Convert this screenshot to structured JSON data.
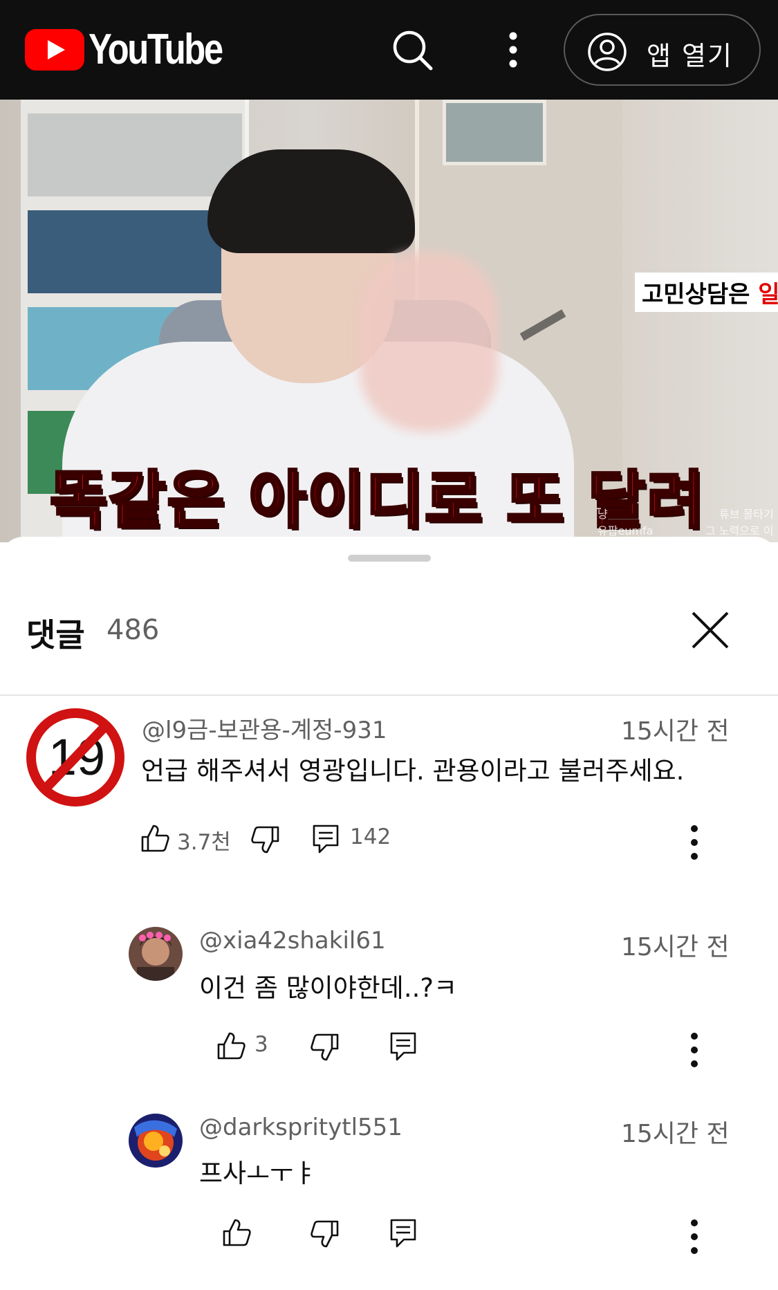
{
  "header": {
    "logo_text": "YouTube",
    "open_app_label": "앱 열기"
  },
  "video": {
    "caption_main": "똑같은 아이디로 또 달려",
    "caption_tag_black": "고민상담은 ",
    "caption_tag_red": "일",
    "overlay_left": "냥",
    "overlay_left2": "유팝eumfa",
    "overlay_right": "튜브 몰타기",
    "overlay_right2": "그 노력으로 이"
  },
  "comments_sheet": {
    "title": "댓글",
    "count": "486"
  },
  "comments": [
    {
      "author": "@l9금-보관용-계정-931",
      "time": "15시간 전",
      "text": "언급 해주셔서 영광입니다. 관용이라고 불러주세요.",
      "likes": "3.7천",
      "replies": "142",
      "avatar_text": "19"
    },
    {
      "author": "@xia42shakil61",
      "time": "15시간 전",
      "text": "이건 좀 많이야한데..?ㅋ",
      "likes": "3"
    },
    {
      "author": "@darkspritytl551",
      "time": "15시간 전",
      "text": "프사ㅗㅜㅑ"
    }
  ],
  "colors": {
    "header_bg": "#0f0f0f",
    "youtube_red": "#ff0000",
    "secondary_text": "#606060",
    "caption_red": "#e8141b"
  }
}
